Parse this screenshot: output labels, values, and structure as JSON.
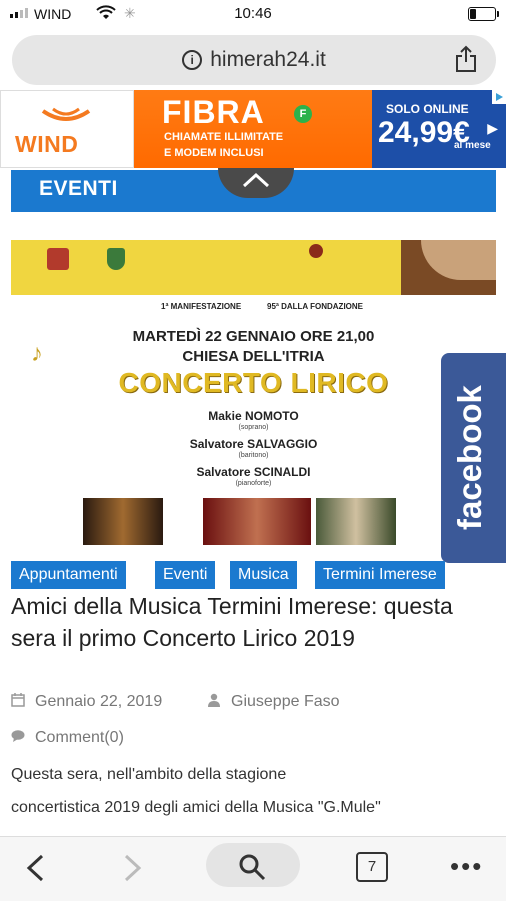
{
  "status_bar": {
    "carrier": "WIND",
    "time": "10:46"
  },
  "browser": {
    "url": "himerah24.it",
    "tabs_count": "7"
  },
  "ad": {
    "brand": "WIND",
    "headline": "FIBRA",
    "badge": "F",
    "line1": "CHIAMATE ILLIMITATE",
    "line2": "E MODEM INCLUSI",
    "solo_online": "SOLO ONLINE",
    "price": "24,99€",
    "per_month": "al mese",
    "colors": {
      "orange": "#ff6a00",
      "blue": "#1d4fa8"
    }
  },
  "section": {
    "title": "EVENTI",
    "accent": "#1b79cf"
  },
  "poster": {
    "manifestazione": "1ª MANIFESTAZIONE",
    "fondazione": "95ª DALLA FONDAZIONE",
    "date_line": "MARTEDÌ 22 GENNAIO ORE 21,00",
    "venue": "CHIESA DELL'ITRIA",
    "event_title": "CONCERTO LIRICO",
    "performers": [
      {
        "name": "Makie NOMOTO",
        "role": "(soprano)"
      },
      {
        "name": "Salvatore SALVAGGIO",
        "role": "(baritono)"
      },
      {
        "name": "Salvatore SCINALDI",
        "role": "(pianoforte)"
      }
    ]
  },
  "facebook_tab": {
    "label": "facebook",
    "color": "#3b5998"
  },
  "categories": [
    "Appuntamenti",
    "Eventi",
    "Musica",
    "Termini Imerese"
  ],
  "article": {
    "title": "Amici della Musica Termini Imerese: questa sera il primo Concerto Lirico 2019",
    "date": "Gennaio 22, 2019",
    "author": "Giuseppe Faso",
    "comments": "Comment(0)",
    "excerpt_line1": "Questa sera, nell'ambito della stagione",
    "excerpt_line2": "concertistica 2019 degli amici della Musica \"G.Mule\""
  }
}
